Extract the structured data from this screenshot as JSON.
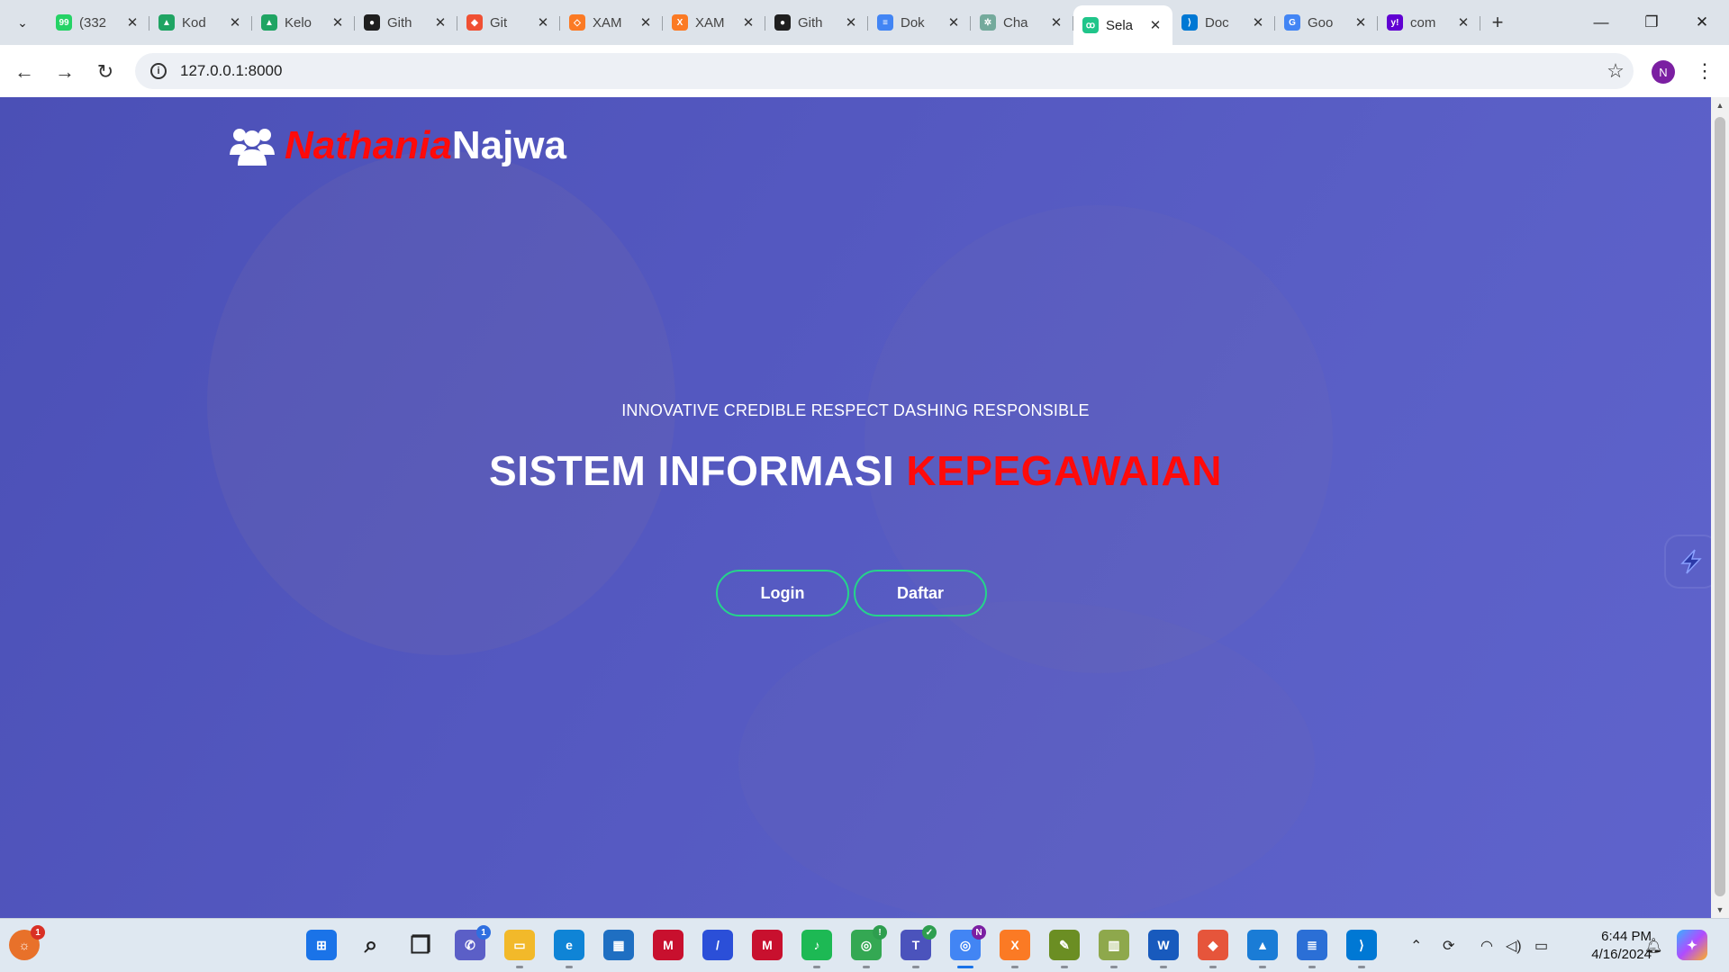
{
  "browser": {
    "tabs": [
      {
        "title": "(332",
        "icon": "whatsapp-icon",
        "color": "#25d366",
        "glyph": "99"
      },
      {
        "title": "Kod",
        "icon": "google-drive-icon",
        "color": "#1fa463",
        "glyph": "▲"
      },
      {
        "title": "Kelo",
        "icon": "google-drive-icon",
        "color": "#1fa463",
        "glyph": "▲"
      },
      {
        "title": "Gith",
        "icon": "github-icon",
        "color": "#1f1f1f",
        "glyph": "●"
      },
      {
        "title": "Git",
        "icon": "git-icon",
        "color": "#f05033",
        "glyph": "◆"
      },
      {
        "title": "XAM",
        "icon": "xampp-icon",
        "color": "#fb7a24",
        "glyph": "◇"
      },
      {
        "title": "XAM",
        "icon": "xampp-icon",
        "color": "#fb7a24",
        "glyph": "X"
      },
      {
        "title": "Gith",
        "icon": "github-icon",
        "color": "#1f1f1f",
        "glyph": "●"
      },
      {
        "title": "Dok",
        "icon": "google-docs-icon",
        "color": "#4285f4",
        "glyph": "≡"
      },
      {
        "title": "Cha",
        "icon": "chatgpt-icon",
        "color": "#74aa9c",
        "glyph": "✲"
      },
      {
        "title": "Sela",
        "icon": "laravel-icon",
        "color": "#20c58a",
        "glyph": "ꝏ",
        "active": true
      },
      {
        "title": "Doc",
        "icon": "vscode-icon",
        "color": "#0078d4",
        "glyph": "⟩"
      },
      {
        "title": "Goo",
        "icon": "google-icon",
        "color": "#4285f4",
        "glyph": "G"
      },
      {
        "title": "com",
        "icon": "yahoo-icon",
        "color": "#6001d2",
        "glyph": "y!"
      }
    ],
    "url": "127.0.0.1:8000",
    "profile_initial": "N"
  },
  "page": {
    "brand": {
      "first": "Nathania",
      "last": "Najwa"
    },
    "tagline": "INNOVATIVE CREDIBLE RESPECT DASHING RESPONSIBLE",
    "headline_white": "SISTEM INFORMASI",
    "headline_red": "KEPEGAWAIAN",
    "login_label": "Login",
    "register_label": "Daftar",
    "colors": {
      "accent_red": "#ff0a0a",
      "button_border": "#25d58a",
      "overlay": "#5458c0"
    }
  },
  "taskbar": {
    "apps": [
      {
        "name": "start-icon",
        "glyph": "⊞",
        "color": "#1a73e8"
      },
      {
        "name": "search-icon",
        "glyph": "⌕",
        "color": "#222"
      },
      {
        "name": "task-view-icon",
        "glyph": "❐",
        "color": "#222"
      },
      {
        "name": "teams-chat-icon",
        "glyph": "✆",
        "color": "#5b5fc7",
        "badge": "1",
        "badge_color": "blue"
      },
      {
        "name": "file-explorer-icon",
        "glyph": "▭",
        "color": "#f2b92a",
        "dot": true
      },
      {
        "name": "edge-icon",
        "glyph": "e",
        "color": "#0f84d6",
        "dot": true
      },
      {
        "name": "store-icon",
        "glyph": "▦",
        "color": "#1f6fc2"
      },
      {
        "name": "mcafee-icon",
        "glyph": "M",
        "color": "#c8102e"
      },
      {
        "name": "app-icon",
        "glyph": "/",
        "color": "#2b4fd8"
      },
      {
        "name": "mcafee-icon",
        "glyph": "M",
        "color": "#c8102e"
      },
      {
        "name": "spotify-icon",
        "glyph": "♪",
        "color": "#1db954",
        "dot": true
      },
      {
        "name": "chrome-icon",
        "glyph": "◎",
        "color": "#34a853",
        "dot": true,
        "badge": "!",
        "badge_color": "green"
      },
      {
        "name": "teams-icon",
        "glyph": "T",
        "color": "#4b53bc",
        "dot": true,
        "badge": "✓",
        "badge_color": "green"
      },
      {
        "name": "chrome-icon",
        "glyph": "◎",
        "color": "#4285f4",
        "dot": true,
        "active": true,
        "badge": "N",
        "badge_color": "purple"
      },
      {
        "name": "xampp-icon",
        "glyph": "X",
        "color": "#fb7a24",
        "dot": true
      },
      {
        "name": "app-icon",
        "glyph": "✎",
        "color": "#6b8e23",
        "dot": true
      },
      {
        "name": "app-icon",
        "glyph": "▥",
        "color": "#8ea84c",
        "dot": true
      },
      {
        "name": "word-icon",
        "glyph": "W",
        "color": "#185abd",
        "dot": true
      },
      {
        "name": "git-icon",
        "glyph": "◆",
        "color": "#e6553b",
        "dot": true
      },
      {
        "name": "photos-icon",
        "glyph": "▲",
        "color": "#1a7cd6",
        "dot": true
      },
      {
        "name": "notepad-icon",
        "glyph": "≣",
        "color": "#2b6fd6",
        "dot": true
      },
      {
        "name": "vscode-icon",
        "glyph": "⟩",
        "color": "#0078d4",
        "dot": true
      }
    ],
    "notification_badge": "1",
    "time": "6:44 PM",
    "date": "4/16/2024"
  }
}
